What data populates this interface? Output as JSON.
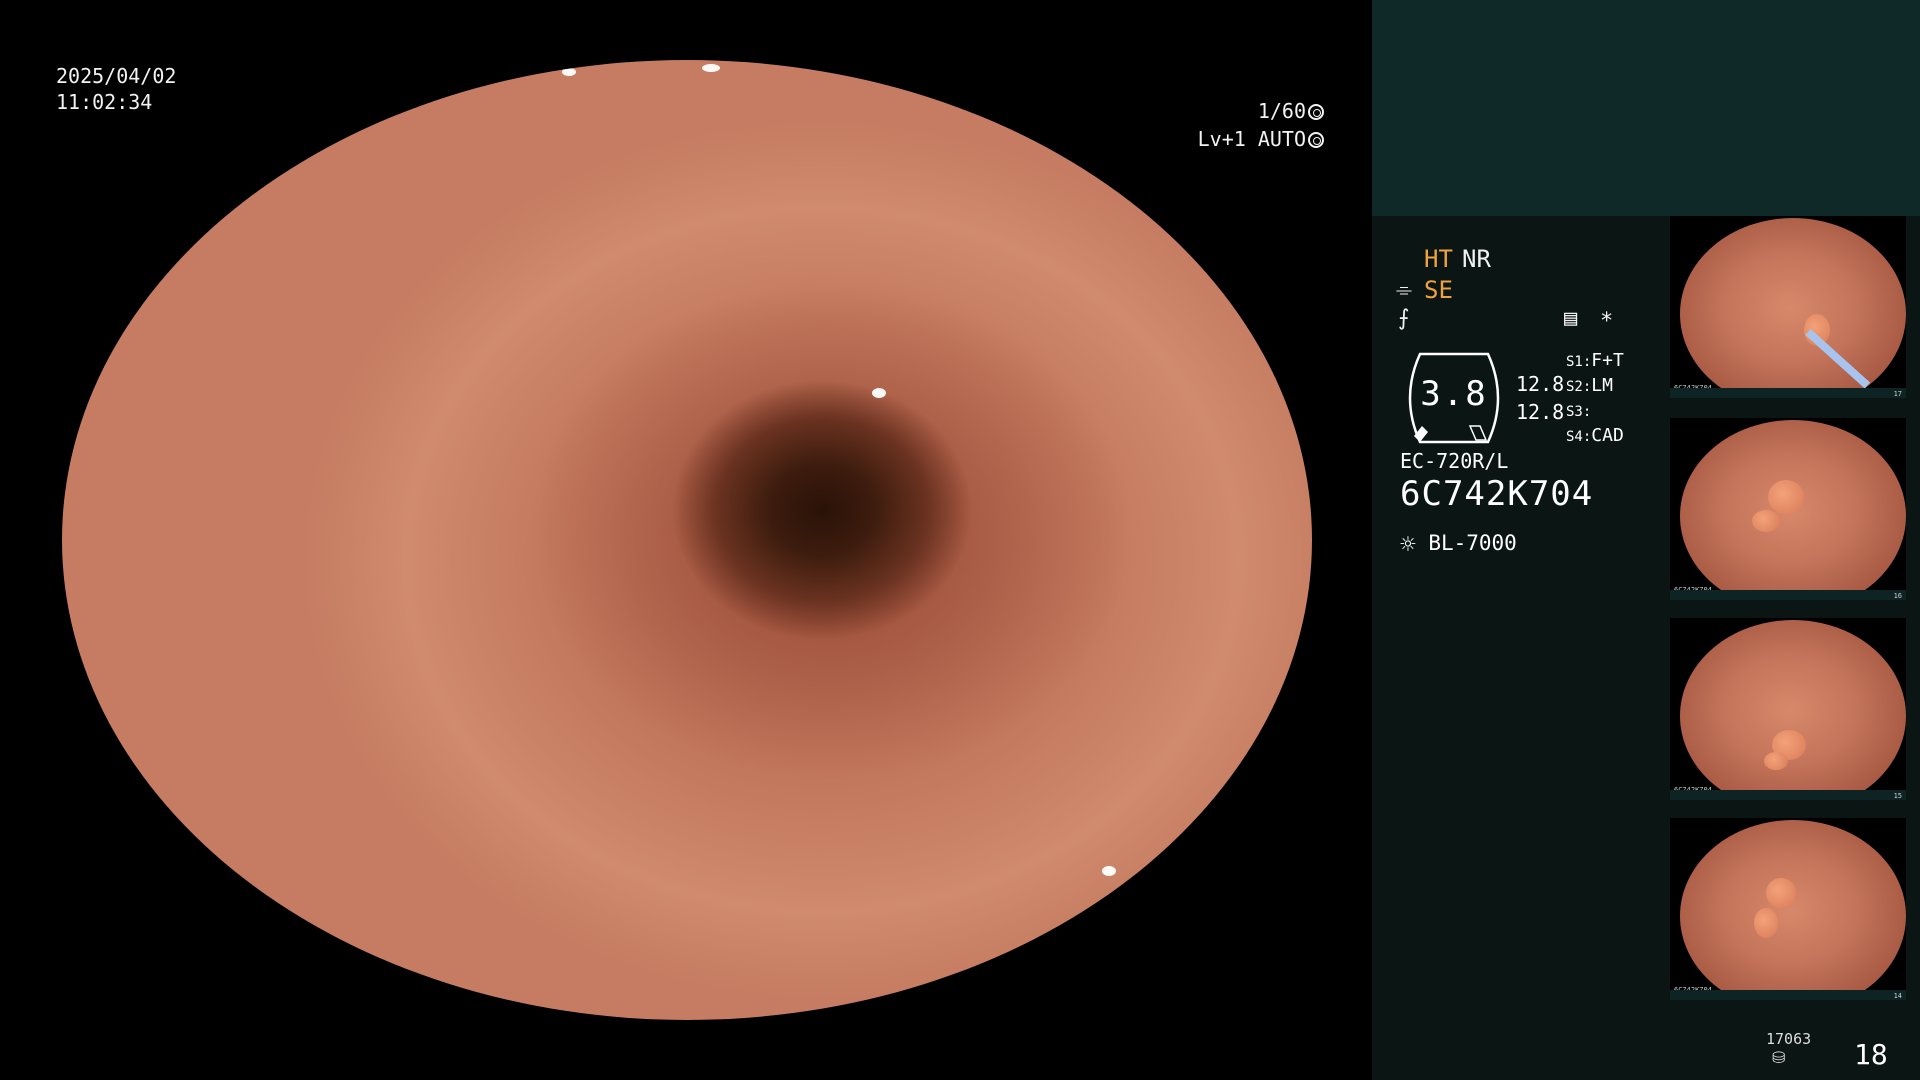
{
  "osd": {
    "date": "2025/04/02",
    "time": "11:02:34",
    "shutter": "1/60",
    "level": "Lv+1 AUTO"
  },
  "panel": {
    "mode1": "HT",
    "mode2": "NR",
    "mode3": "SE",
    "gauge_value": "3.8",
    "gauge_top": "12.8",
    "gauge_bottom": "12.8",
    "switches": [
      {
        "key": "S1:",
        "value": "F+T"
      },
      {
        "key": "S2:",
        "value": "LM"
      },
      {
        "key": "S3:",
        "value": ""
      },
      {
        "key": "S4:",
        "value": "CAD"
      }
    ],
    "scope_model": "EC-720R/L",
    "scope_serial": "6C742K704",
    "light_source": "BL-7000",
    "storage_count": "17063",
    "image_count": "18"
  },
  "thumbnails": [
    {
      "id": "6C742K704",
      "index": "17"
    },
    {
      "id": "6C742K704",
      "index": "16"
    },
    {
      "id": "6C742K704",
      "index": "15"
    },
    {
      "id": "6C742K704",
      "index": "14"
    }
  ],
  "colors": {
    "accent": "#f0a33c",
    "panel_bg": "#0b1514",
    "panel_top": "#0f2828"
  }
}
